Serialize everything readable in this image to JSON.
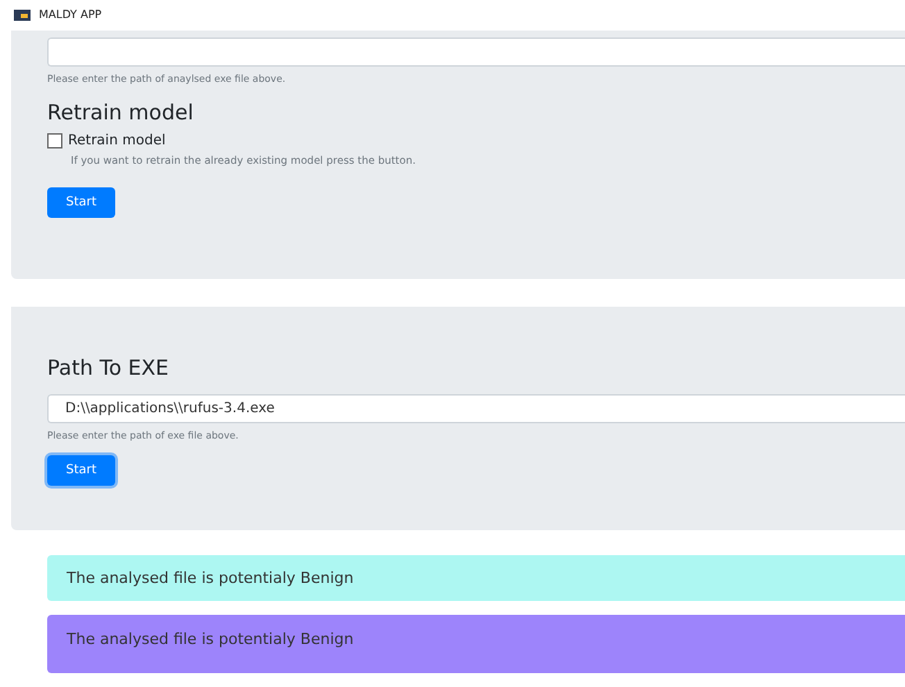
{
  "window": {
    "title": "MALDY APP"
  },
  "analyse_panel": {
    "hint": "Please enter the path of anaylsed exe file above.",
    "heading": "Retrain model",
    "checkbox": {
      "label": "Retrain model",
      "checked": false
    },
    "description": "If you want to retrain the already existing model press the button.",
    "button": {
      "label": "Start",
      "focused": false
    }
  },
  "path_panel": {
    "heading": "Path To EXE",
    "field": {
      "value": "D:\\\\applications\\\\rufus-3.4.exe"
    },
    "hint": "Please enter the path of exe file above.",
    "button": {
      "label": "Start",
      "focused": true
    }
  },
  "alerts": [
    {
      "text": "The analysed file is potentialy Benign",
      "color": "#adf7f2"
    },
    {
      "text": "The analysed file is potentialy Benign",
      "color": "#9d84fb"
    }
  ]
}
